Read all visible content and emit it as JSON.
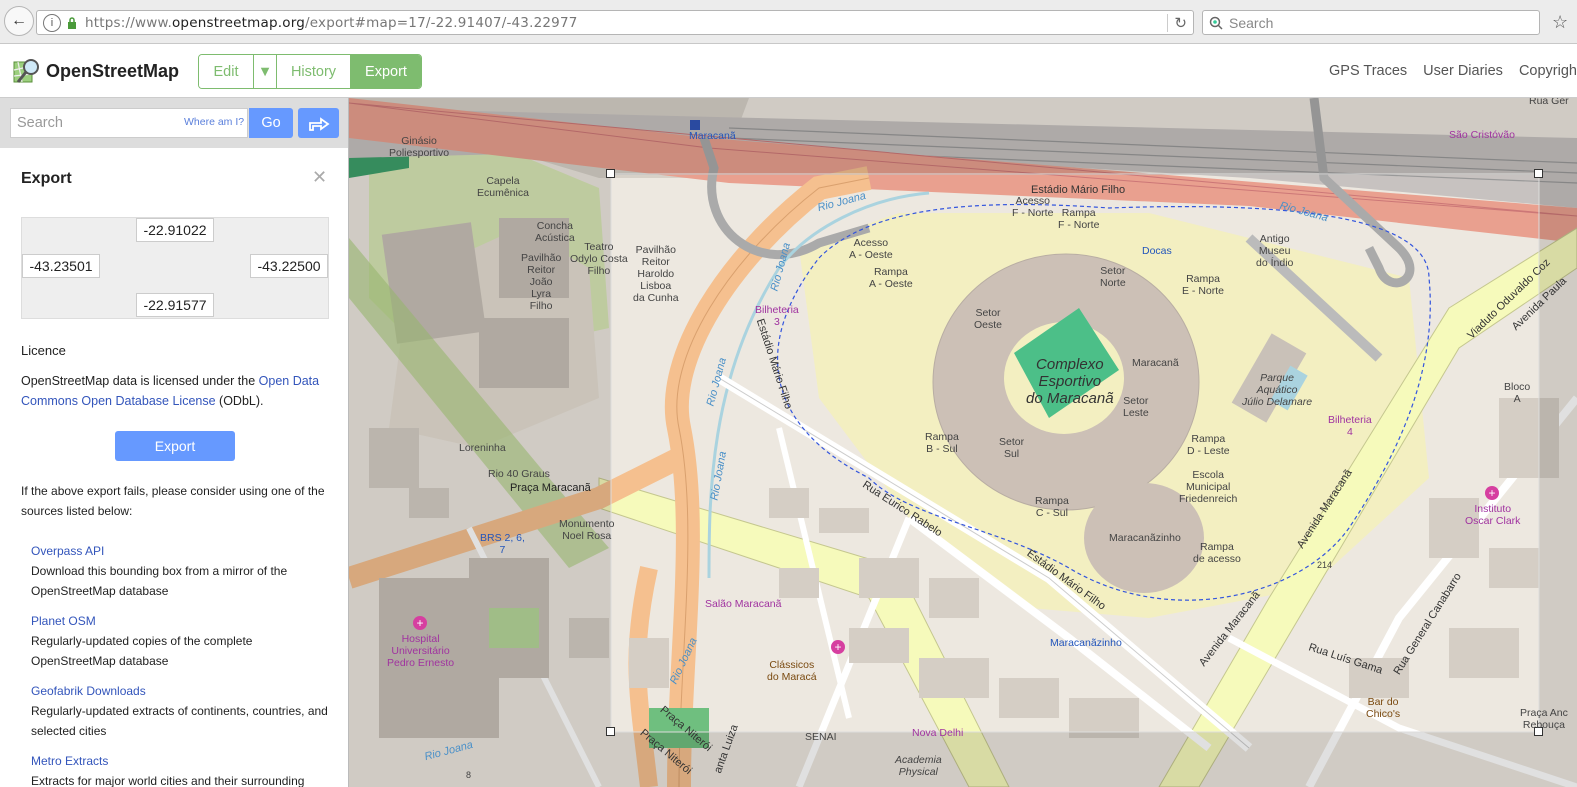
{
  "browser": {
    "url_prefix": "https://www.",
    "url_host": "openstreetmap.org",
    "url_path": "/export#map=17/-22.91407/-43.22977",
    "search_placeholder": "Search"
  },
  "header": {
    "brand": "OpenStreetMap",
    "edit_label": "Edit",
    "history_label": "History",
    "export_label": "Export",
    "nav": [
      "GPS Traces",
      "User Diaries",
      "Copyright"
    ]
  },
  "sidebar": {
    "search_placeholder": "Search",
    "where_am_i": "Where am I?",
    "go_label": "Go",
    "export_title": "Export",
    "bbox": {
      "north": "-22.91022",
      "west": "-43.23501",
      "east": "-43.22500",
      "south": "-22.91577"
    },
    "licence_heading": "Licence",
    "licence_pre": "OpenStreetMap data is licensed under the ",
    "licence_link": "Open Data Commons Open Database License",
    "licence_post": " (ODbL).",
    "export_button": "Export",
    "fail_text": "If the above export fails, please consider using one of the sources listed below:",
    "sources": [
      {
        "name": "Overpass API",
        "desc": "Download this bounding box from a mirror of the OpenStreetMap database"
      },
      {
        "name": "Planet OSM",
        "desc": "Regularly-updated copies of the complete OpenStreetMap database"
      },
      {
        "name": "Geofabrik Downloads",
        "desc": "Regularly-updated extracts of continents, countries, and selected cities"
      },
      {
        "name": "Metro Extracts",
        "desc": "Extracts for major world cities and their surrounding"
      }
    ]
  },
  "map": {
    "labels": {
      "maracana_station": "Maracanã",
      "ginasio": "Ginásio\nPoliesportivo",
      "capela": "Capela\nEcumênica",
      "concha": "Concha\nAcústica",
      "teatro": "Teatro\nOdylo Costa\nFilho",
      "pav_joao": "Pavilhão\nReitor\nJoão\nLyra\nFilho",
      "pav_haroldo": "Pavilhão\nReitor\nHaroldo\nLisboa\nda Cunha",
      "complexo": "Complexo\nEsportivo\ndo Maracanã",
      "estadio_top": "Estádio Mário Filho",
      "acesso_f": "Acesso\nF - Norte",
      "rampa_f": "Rampa\nF - Norte",
      "docas": "Docas",
      "antigo_museu": "Antigo\nMuseu\ndo Índio",
      "acesso_a": "Acesso\nA - Oeste",
      "rampa_a": "Rampa\nA - Oeste",
      "bilheteria3": "Bilheteria\n3",
      "setor_norte": "Setor\nNorte",
      "setor_oeste": "Setor\nOeste",
      "setor_leste": "Setor\nLeste",
      "setor_sul": "Setor\nSul",
      "maracana_sector": "Maracanã",
      "rampa_e": "Rampa\nE - Norte",
      "parque": "Parque\nAquático\nJúlio Delamare",
      "bilheteria4": "Bilheteria\n4",
      "bloco_a": "Bloco\nA",
      "rampa_b": "Rampa\nB - Sul",
      "rampa_d": "Rampa\nD - Leste",
      "escola": "Escola\nMunicipal\nFriedenreich",
      "rampa_c": "Rampa\nC - Sul",
      "maracanazinho": "Maracanãzinho",
      "rampa_acesso": "Rampa\nde acesso",
      "instituto": "Instituto\nOscar Clark",
      "loreninha": "Loreninha",
      "rio40": "Rio 40 Graus",
      "praca_maracana": "Praça Maracanã",
      "monumento": "Monumento\nNoel Rosa",
      "brs": "BRS 2, 6,\n7",
      "hospital": "Hospital\nUniversitário\nPedro Ernesto",
      "salao": "Salão Maracanã",
      "classicos": "Clássicos\ndo Maracá",
      "maracanazinho_blue": "Maracanãzinho",
      "senai": "SENAI",
      "nova_delhi": "Nova Delhi",
      "academia": "Academia\nPhysical",
      "bar_chico": "Bar do\nChico's",
      "praca_rebouca": "Praça Anc\nRebouça",
      "sao_cristovao": "São Cristóvão",
      "rua_ger": "Rua Ger",
      "num214": "214",
      "num8": "8"
    },
    "streets": {
      "rua_eurico": "Rua Eurico Rabelo",
      "estadio_mario": "Estádio Mário Filho",
      "estadio_mario_2": "Estádio Mário Filho",
      "avenida_maracana": "Avenida Maracanã",
      "avenida_maracana_2": "Avenida Maracanã",
      "rua_luis_gama": "Rua Luís Gama",
      "rua_canabarro": "Rua General Canabarro",
      "viaduto": "Viaduto Oduvaldo Coz",
      "avenida_paula": "Avenida Paula",
      "praca_niteroi": "Praça Niterói",
      "praca_niteroi_2": "Praça Niterói",
      "anta_luiza": "anta Luiza",
      "rio_joana_1": "Rio Joana",
      "rio_joana_2": "Rio Joana",
      "rio_joana_3": "Rio Joana",
      "rio_joana_4": "Rio Joana",
      "rio_joana_5": "Rio Joana",
      "rio_joana_6": "Rio Joana",
      "rio_joana_7": "Rio Joana"
    }
  }
}
